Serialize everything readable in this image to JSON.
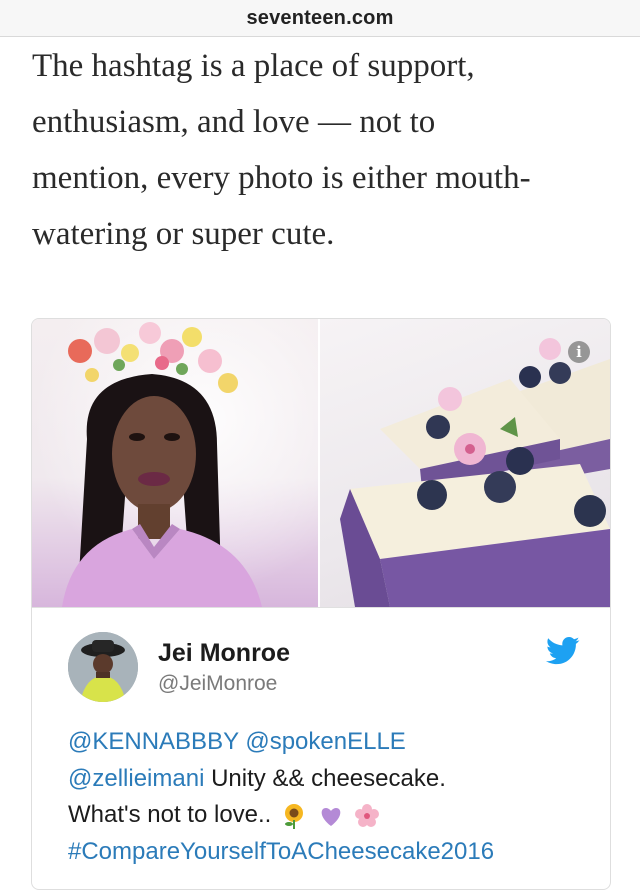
{
  "browser": {
    "url": "seventeen.com"
  },
  "article": {
    "lines": [
      "The hashtag is a place of support,",
      "enthusiasm, and love — not to",
      "mention, every photo is either mouth-",
      "watering or super cute."
    ]
  },
  "embed": {
    "info_icon_glyph": "i",
    "tweet": {
      "author_name": "Jei Monroe",
      "author_handle": "@JeiMonroe",
      "mention_1": "@KENNABBBY",
      "mention_2": "@spokenELLE",
      "mention_3": "@zellieimani",
      "text_1": " Unity && cheesecake.",
      "text_2": "What's not to love.. ",
      "hashtag": "#CompareYourselfToACheesecake2016",
      "emojis": [
        "sunflower-icon",
        "purple-heart-icon",
        "cherry-blossom-icon"
      ],
      "colors": {
        "link": "#2b7bb9",
        "bird": "#1da1f2"
      }
    }
  }
}
